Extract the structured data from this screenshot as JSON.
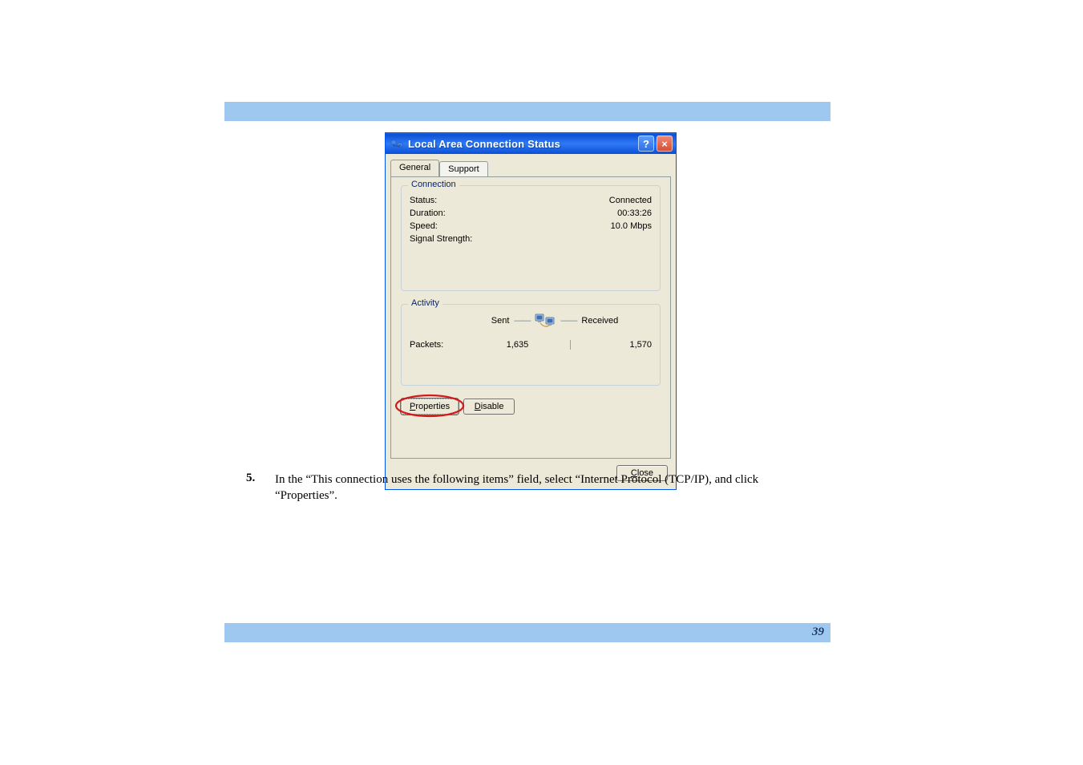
{
  "page": {
    "number": "39"
  },
  "dialog": {
    "title": "Local Area Connection Status",
    "helpButton": "?",
    "closeButton": "×",
    "tabs": {
      "general": "General",
      "support": "Support"
    },
    "connection": {
      "legend": "Connection",
      "statusLabel": "Status:",
      "statusValue": "Connected",
      "durationLabel": "Duration:",
      "durationValue": "00:33:26",
      "speedLabel": "Speed:",
      "speedValue": "10.0 Mbps",
      "signalLabel": "Signal Strength:"
    },
    "activity": {
      "legend": "Activity",
      "sentLabel": "Sent",
      "receivedLabel": "Received",
      "packetsLabel": "Packets:",
      "sentValue": "1,635",
      "receivedValue": "1,570"
    },
    "buttons": {
      "properties_prefix": "P",
      "properties_rest": "roperties",
      "disable_prefix": "D",
      "disable_rest": "isable",
      "close_prefix": "C",
      "close_rest": "lose"
    }
  },
  "instruction": {
    "number": "5.",
    "text": "In the “This connection uses the following items” field, select “Internet Protocol (TCP/IP), and click “Properties”."
  }
}
